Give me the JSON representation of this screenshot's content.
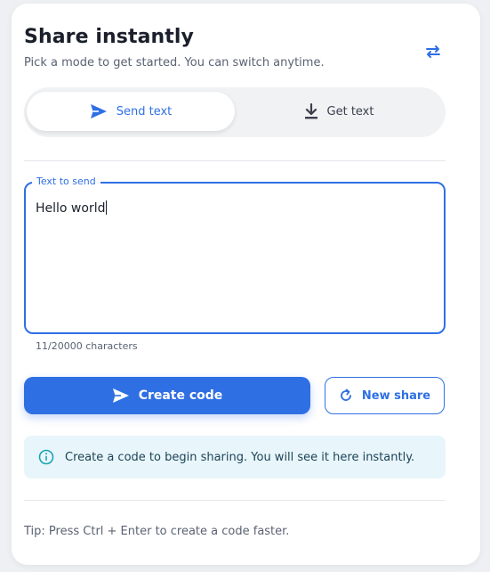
{
  "header": {
    "title": "Share instantly",
    "subtitle": "Pick a mode to get started. You can switch anytime.",
    "swap_icon": "swap-arrows-icon"
  },
  "modes": {
    "active": "Send text",
    "items": [
      {
        "label": "Send text",
        "icon": "send-icon",
        "active": true
      },
      {
        "label": "Get text",
        "icon": "download-icon",
        "active": false
      }
    ]
  },
  "editor": {
    "legend": "Text to send",
    "value": "Hello world",
    "counter": "11/20000 characters"
  },
  "actions": {
    "create_label": "Create code",
    "new_label": "New share"
  },
  "info": {
    "icon": "info-icon",
    "text": "Create a code to begin sharing. You will see it here instantly."
  },
  "tip": "Tip: Press Ctrl + Enter to create a code faster.",
  "colors": {
    "accent": "#2f6fe4",
    "info_bg": "#e8f6fb",
    "info_icon": "#1aa3b5"
  }
}
